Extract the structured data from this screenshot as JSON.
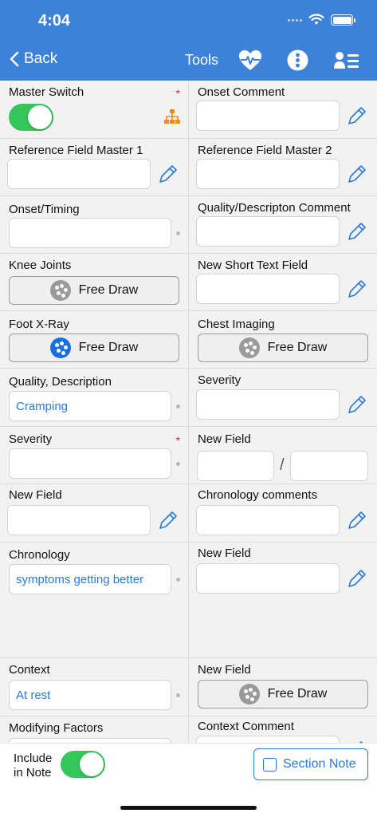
{
  "status_bar": {
    "time": "4:04"
  },
  "nav": {
    "back_label": "Back",
    "tools_label": "Tools",
    "icons": [
      "chevron-left-icon",
      "heart-pulse-icon",
      "more-vertical-icon",
      "user-list-icon"
    ]
  },
  "form": {
    "master_switch": {
      "label": "Master Switch",
      "on": true,
      "required_mark": "*"
    },
    "onset_comment": {
      "label": "Onset Comment",
      "value": ""
    },
    "reference_field_master_1": {
      "label": "Reference Field Master 1",
      "value": ""
    },
    "reference_field_master_2": {
      "label": "Reference Field Master 2",
      "value": ""
    },
    "onset_timing": {
      "label": "Onset/Timing",
      "value": ""
    },
    "quality_description_comment": {
      "label": "Quality/Descripton Comment",
      "value": ""
    },
    "knee_joints": {
      "label": "Knee Joints",
      "button": "Free Draw"
    },
    "new_short_text_field": {
      "label": "New Short Text Field",
      "value": ""
    },
    "foot_xray": {
      "label": "Foot X-Ray",
      "button": "Free Draw"
    },
    "chest_imaging": {
      "label": "Chest Imaging",
      "button": "Free Draw"
    },
    "quality_description": {
      "label": "Quality, Description",
      "value": "Cramping"
    },
    "severity_comment": {
      "label": "Severity",
      "value": ""
    },
    "severity": {
      "label": "Severity",
      "value": "",
      "required_mark": "*"
    },
    "new_field_fraction": {
      "label": "New Field",
      "separator": "/",
      "value_a": "",
      "value_b": ""
    },
    "new_field_text": {
      "label": "New Field",
      "value": ""
    },
    "chronology_comments": {
      "label": "Chronology comments",
      "value": ""
    },
    "chronology": {
      "label": "Chronology",
      "value": "symptoms getting better"
    },
    "new_field_text_2": {
      "label": "New Field",
      "value": ""
    },
    "context": {
      "label": "Context",
      "value": "At rest"
    },
    "new_field_draw": {
      "label": "New Field",
      "button": "Free Draw"
    },
    "modifying_factors": {
      "label": "Modifying Factors"
    },
    "context_comment": {
      "label": "Context Comment"
    }
  },
  "footer": {
    "include_label_1": "Include",
    "include_label_2": "in Note",
    "include_on": true,
    "section_note_label": "Section Note"
  },
  "colors": {
    "header": "#3c82d8",
    "accent": "#2a7ad6",
    "toggle_on": "#34c759",
    "required": "#e02020",
    "hierarchy_icon": "#f08a1c"
  }
}
